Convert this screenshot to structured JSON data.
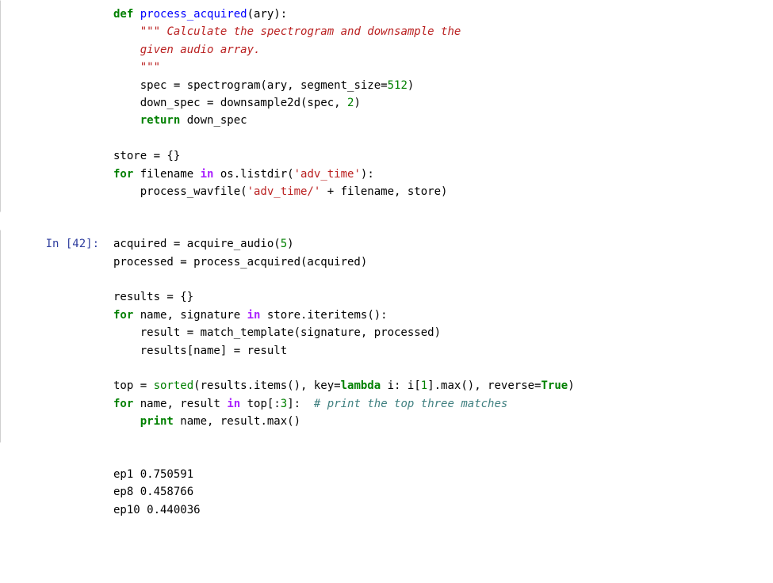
{
  "cell1": {
    "prompt": "",
    "code": {
      "def_kw": "def",
      "def_name": "process_acquired",
      "def_params": "(ary):",
      "doc_open": "\"\"\" ",
      "doc_line1": "Calculate the spectrogram and downsample the",
      "doc_line2": "given audio array.",
      "doc_close": "\"\"\"",
      "line_spec": "spec = spectrogram(ary, segment_size=",
      "num_512": "512",
      "close_paren": ")",
      "line_down": "down_spec = downsample2d(spec, ",
      "num_2": "2",
      "close_paren2": ")",
      "return_kw": "return",
      "return_val": " down_spec",
      "store_line": "store = {}",
      "for_kw": "for",
      "for_rest1": " filename ",
      "in_kw": "in",
      "for_rest2": " os.listdir(",
      "str_adv1": "'adv_time'",
      "for_close": "):",
      "call_prefix": "    process_wavfile(",
      "str_adv2": "'adv_time/'",
      "call_rest": " + filename, store)"
    }
  },
  "cell2": {
    "prompt": "In [42]:",
    "code": {
      "acq_line": "acquired = acquire_audio(",
      "num_5": "5",
      "close_paren": ")",
      "proc_line": "processed = process_acquired(acquired)",
      "results_line": "results = {}",
      "for_kw": "for",
      "for_rest1": " name, signature ",
      "in_kw": "in",
      "for_rest2": " store.iteritems():",
      "body1": "    result = match_template(signature, processed)",
      "body2": "    results[name] = result",
      "top_assign": "top = ",
      "sorted_kw": "sorted",
      "sorted_args": "(results.items(), key=",
      "lambda_kw": "lambda",
      "lambda_body": " i: i[",
      "num_1": "1",
      "lambda_rest": "].max(), reverse=",
      "true_kw": "True",
      "close_paren2": ")",
      "for2_kw": "for",
      "for2_rest1": " name, result ",
      "in_kw2": "in",
      "for2_rest2": " top[:",
      "num_3": "3",
      "for2_rest3": "]:  ",
      "comment": "# print the top three matches",
      "print_kw": "print",
      "print_rest": " name, result.max()"
    },
    "output": "\nep1 0.750591\nep8 0.458766\nep10 0.440036"
  }
}
